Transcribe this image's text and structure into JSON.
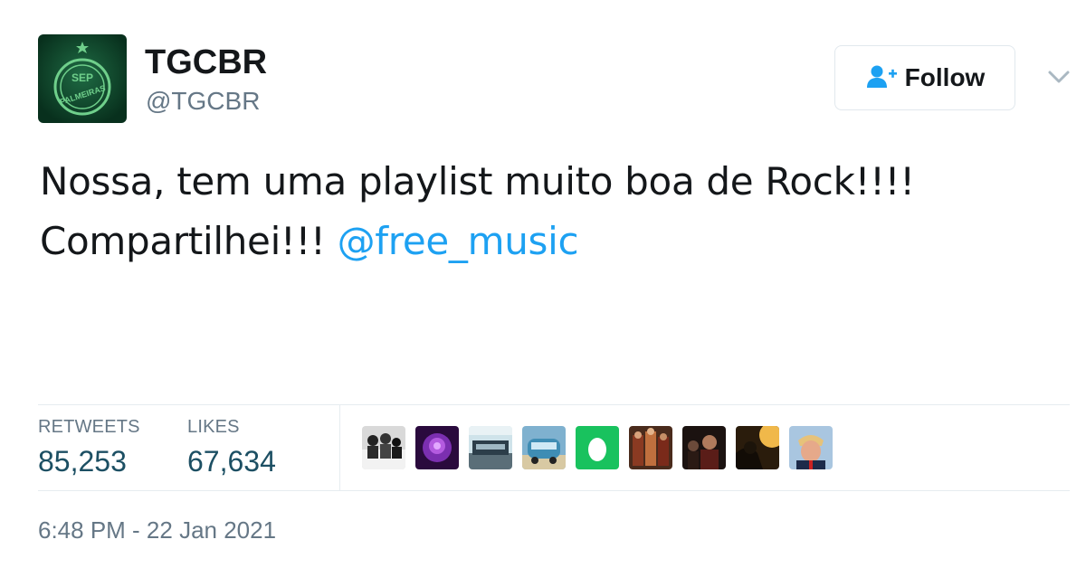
{
  "user": {
    "display_name": "TGCBR",
    "handle": "@TGCBR",
    "avatar_text": "PALMEIRAS"
  },
  "follow_button": {
    "label": "Follow",
    "icon": "add-user-icon"
  },
  "menu_icon": "chevron-down-icon",
  "tweet": {
    "line1": "Nossa, tem uma playlist muito boa de Rock!!!!",
    "line2": "Compartilhei!!! ",
    "mention": "@free_music"
  },
  "stats": {
    "retweets_label": "RETWEETS",
    "retweets_value": "85,253",
    "likes_label": "LIKES",
    "likes_value": "67,634"
  },
  "likers": [
    {
      "name": "liker-avatar-1"
    },
    {
      "name": "liker-avatar-2"
    },
    {
      "name": "liker-avatar-3"
    },
    {
      "name": "liker-avatar-4"
    },
    {
      "name": "liker-avatar-5"
    },
    {
      "name": "liker-avatar-6"
    },
    {
      "name": "liker-avatar-7"
    },
    {
      "name": "liker-avatar-8"
    },
    {
      "name": "liker-avatar-9"
    }
  ],
  "timestamp": "6:48 PM - 22 Jan 2021",
  "colors": {
    "link": "#1da1f2",
    "text": "#14171a",
    "muted": "#657786",
    "border": "#e6ecf0",
    "avatar_green": "#0d3b26"
  }
}
